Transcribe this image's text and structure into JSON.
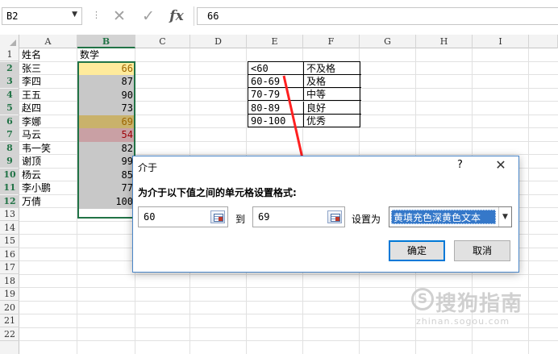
{
  "formula_bar": {
    "name_box": "B2",
    "cancel_icon": "✕",
    "enter_icon": "✓",
    "fx_label": "fx",
    "value": "66"
  },
  "columns": [
    "A",
    "B",
    "C",
    "D",
    "E",
    "F",
    "G",
    "H",
    "I"
  ],
  "selected_column": "B",
  "rows": [
    "1",
    "2",
    "3",
    "4",
    "5",
    "6",
    "7",
    "8",
    "9",
    "10",
    "11",
    "12",
    "13",
    "14",
    "15",
    "16",
    "17",
    "18",
    "19",
    "20",
    "21",
    "22"
  ],
  "sheet": {
    "header": {
      "name": "姓名",
      "score": "数学"
    },
    "records": [
      {
        "name": "张三",
        "score": "66",
        "fill": "#ffeb9c",
        "color": "#9c6500"
      },
      {
        "name": "李四",
        "score": "87",
        "fill": "#c8c8c8",
        "color": "#000000"
      },
      {
        "name": "王五",
        "score": "90",
        "fill": "#c8c8c8",
        "color": "#000000"
      },
      {
        "name": "赵四",
        "score": "73",
        "fill": "#c8c8c8",
        "color": "#000000"
      },
      {
        "name": "李娜",
        "score": "69",
        "fill": "#c9b26b",
        "color": "#9c6500"
      },
      {
        "name": "马云",
        "score": "54",
        "fill": "#c9a0a4",
        "color": "#9c0006"
      },
      {
        "name": "韦一笑",
        "score": "82",
        "fill": "#c8c8c8",
        "color": "#000000"
      },
      {
        "name": "谢顶",
        "score": "99",
        "fill": "#c8c8c8",
        "color": "#000000"
      },
      {
        "name": "杨云",
        "score": "85",
        "fill": "#c8c8c8",
        "color": "#000000"
      },
      {
        "name": "李小鹏",
        "score": "77",
        "fill": "#c8c8c8",
        "color": "#000000"
      },
      {
        "name": "万倩",
        "score": "100",
        "fill": "#c8c8c8",
        "color": "#000000"
      }
    ],
    "grade_table": [
      {
        "range": "<60",
        "grade": "不及格"
      },
      {
        "range": "60-69",
        "grade": "及格"
      },
      {
        "range": "70-79",
        "grade": "中等"
      },
      {
        "range": "80-89",
        "grade": "良好"
      },
      {
        "range": "90-100",
        "grade": "优秀"
      }
    ]
  },
  "dialog": {
    "title": "介于",
    "help": "?",
    "close": "✕",
    "prompt": "为介于以下值之间的单元格设置格式:",
    "from_value": "60",
    "to_label": "到",
    "to_value": "69",
    "set_as_label": "设置为",
    "format_value": "黄填充色深黄色文本",
    "ok_label": "确定",
    "cancel_label": "取消"
  },
  "watermark": {
    "text": "搜狗指南",
    "letter": "S",
    "url": "zhinan.sogou.com"
  },
  "colors": {
    "accent": "#217346",
    "arrow": "#ff2020",
    "selection": "#3578c9"
  }
}
